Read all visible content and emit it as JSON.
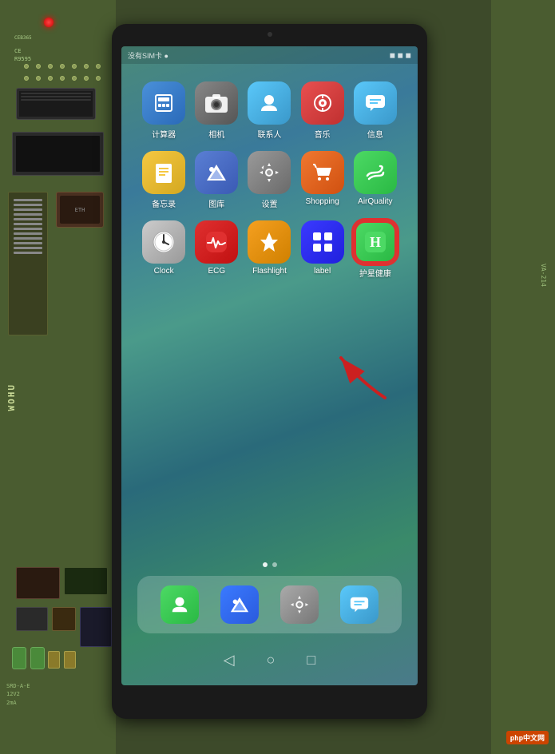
{
  "pcb": {
    "led_color": "#ff0000",
    "board_label": "WOHU"
  },
  "status_bar": {
    "left_text": "没有SIM卡 ●",
    "right_text": "◼ ◼ ◼"
  },
  "apps": {
    "row1": [
      {
        "id": "calc",
        "label": "计算器",
        "icon_type": "calc"
      },
      {
        "id": "camera",
        "label": "相机",
        "icon_type": "camera"
      },
      {
        "id": "contacts",
        "label": "联系人",
        "icon_type": "contacts"
      },
      {
        "id": "music",
        "label": "音乐",
        "icon_type": "music"
      },
      {
        "id": "messages",
        "label": "信息",
        "icon_type": "messages"
      }
    ],
    "row2": [
      {
        "id": "notes",
        "label": "备忘录",
        "icon_type": "notes"
      },
      {
        "id": "gallery",
        "label": "图库",
        "icon_type": "gallery"
      },
      {
        "id": "settings",
        "label": "设置",
        "icon_type": "settings"
      },
      {
        "id": "shopping",
        "label": "Shopping",
        "icon_type": "shopping"
      },
      {
        "id": "airquality",
        "label": "AirQuality",
        "icon_type": "airquality"
      }
    ],
    "row3": [
      {
        "id": "clock",
        "label": "Clock",
        "icon_type": "clock"
      },
      {
        "id": "ecg",
        "label": "ECG",
        "icon_type": "ecg"
      },
      {
        "id": "flashlight",
        "label": "Flashlight",
        "icon_type": "flashlight"
      },
      {
        "id": "label_app",
        "label": "label",
        "icon_type": "label"
      },
      {
        "id": "health",
        "label": "护星健康",
        "icon_type": "health",
        "highlighted": true
      }
    ]
  },
  "dock": {
    "items": [
      {
        "id": "contacts_dock",
        "icon_type": "contacts_dock"
      },
      {
        "id": "gallery_dock",
        "icon_type": "gallery_dock"
      },
      {
        "id": "settings_dock",
        "icon_type": "settings_dock"
      },
      {
        "id": "messages_dock",
        "icon_type": "messages_dock"
      }
    ]
  },
  "nav": {
    "back": "◁",
    "home": "○",
    "recents": "□"
  },
  "watermark": {
    "text": "php中文网"
  },
  "right_side_label": "VA-214"
}
